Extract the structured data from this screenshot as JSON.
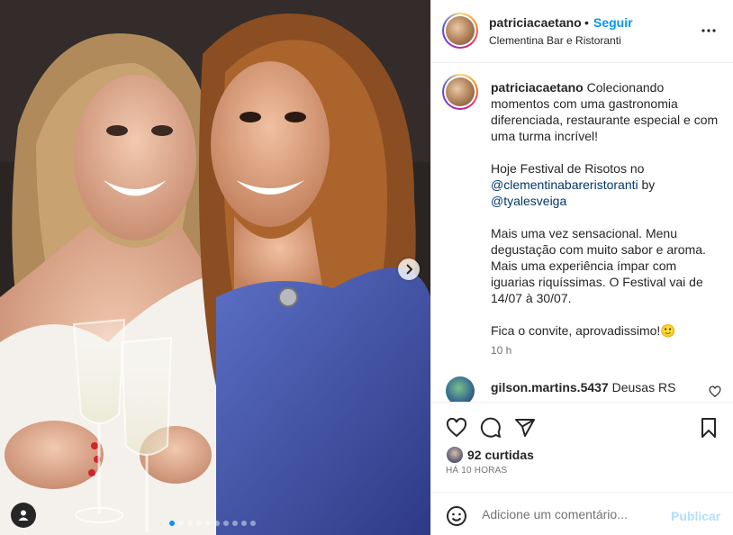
{
  "post": {
    "username": "patriciacaetano",
    "separator": "•",
    "follow_label": "Seguir",
    "location": "Clementina Bar e Ristoranti"
  },
  "caption": {
    "username": "patriciacaetano",
    "line1": "Colecionando momentos com uma gastronomia diferenciada, restaurante especial e com uma turma incrível!",
    "line2_prefix": "Hoje Festival de Risotos no",
    "mention1": "@clementinabareristoranti",
    "by": "by",
    "mention2": "@tyalesveiga",
    "line3": "Mais uma vez sensacional. Menu degustação com muito sabor e aroma. Mais uma experiência ímpar com iguarias riquíssimas. O Festival vai de 14/07 à 30/07.",
    "line4": "Fica o convite, aprovadissimo!",
    "emoji": "🙂",
    "time": "10 h"
  },
  "comment": {
    "username": "gilson.martins.5437",
    "text": "Deusas RS"
  },
  "stats": {
    "likes": "92 curtidas",
    "time_ago": "HÁ 10 HORAS"
  },
  "composer": {
    "placeholder": "Adicione um comentário...",
    "post_label": "Publicar"
  },
  "carousel": {
    "total_slides": 10,
    "active_index": 0
  },
  "icons": {
    "more": "more-options-icon",
    "like": "heart-icon",
    "comment": "comment-icon",
    "share": "share-icon",
    "save": "bookmark-icon",
    "emoji": "emoji-icon",
    "next": "chevron-right-icon",
    "user_tag": "user-tag-icon"
  },
  "colors": {
    "accent": "#0095f6",
    "link": "#00376b",
    "muted": "#737373",
    "publish_disabled": "#b2dffc"
  }
}
